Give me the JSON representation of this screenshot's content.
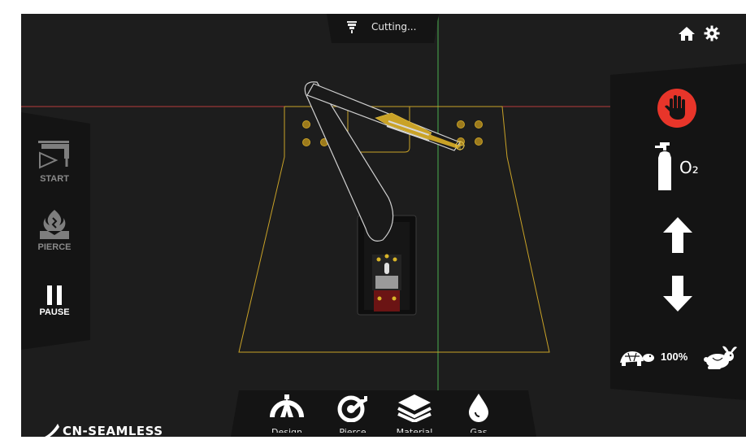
{
  "status": {
    "text": "Cutting...",
    "icon": "torch-icon"
  },
  "header_icons": [
    "home-icon",
    "gear-icon"
  ],
  "left_controls": [
    {
      "label": "START",
      "icon": "start-torch-icon",
      "enabled": false
    },
    {
      "label": "PIERCE",
      "icon": "pierce-flame-icon",
      "enabled": false
    },
    {
      "label": "PAUSE",
      "icon": "pause-icon",
      "enabled": true
    }
  ],
  "right_controls": {
    "stop_icon": "stop-hand-icon",
    "oxygen_icon": "oxygen-tank-icon",
    "oxygen_label": "O₂",
    "up_icon": "arrow-up-icon",
    "down_icon": "arrow-down-icon",
    "speed": {
      "value": "100%",
      "slow_icon": "turtle-icon",
      "fast_icon": "rabbit-icon"
    }
  },
  "bottom_nav": [
    {
      "label": "Design",
      "icon": "design-arc-icon"
    },
    {
      "label": "Pierce",
      "icon": "target-icon"
    },
    {
      "label": "Material",
      "icon": "layers-icon"
    },
    {
      "label": "Gas",
      "icon": "drop-icon"
    }
  ],
  "logo": {
    "text": "CN-SEAMLESS"
  },
  "colors": {
    "background": "#1d1d1d",
    "panel": "#141414",
    "accent_red": "#e8352a",
    "crosshair_green": "#4caf50",
    "crosshair_red": "#b83a3a",
    "outline_gold": "#c9a227"
  }
}
